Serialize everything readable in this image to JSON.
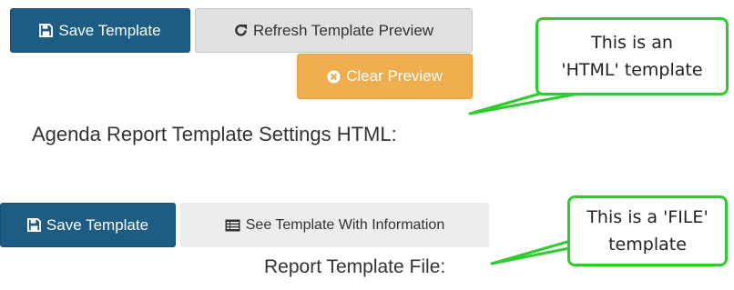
{
  "html_section": {
    "save_button": "Save Template",
    "refresh_button": "Refresh Template Preview",
    "clear_button": "Clear Preview",
    "heading": "Agenda Report Template Settings HTML:"
  },
  "file_section": {
    "save_button": "Save Template",
    "see_button": "See Template With Information",
    "heading": "Report Template File:"
  },
  "callouts": {
    "html": {
      "line1": "This is an",
      "line2": "'HTML' template"
    },
    "file": {
      "line1": "This is a 'FILE'",
      "line2": "template"
    }
  },
  "colors": {
    "primary": "#1d5c84",
    "warning": "#f0ad4e",
    "callout_border": "#2ecc2e"
  }
}
